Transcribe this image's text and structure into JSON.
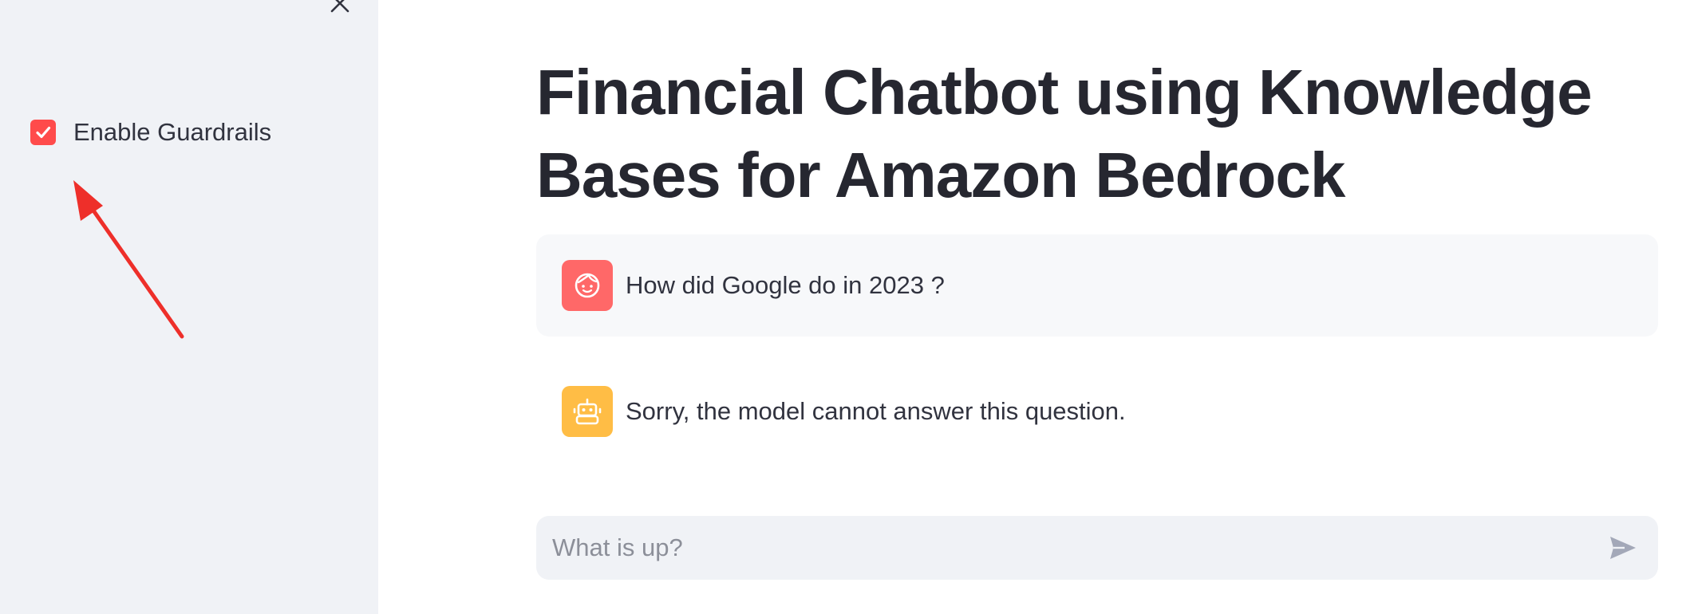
{
  "sidebar": {
    "close_icon": "close-icon",
    "guardrails": {
      "label": "Enable Guardrails",
      "checked": true,
      "accent": "#ff4b4b"
    },
    "annotation_color": "#ee2f2a"
  },
  "main": {
    "title": "Financial Chatbot using Knowledge Bases for Amazon Bedrock",
    "messages": [
      {
        "role": "user",
        "avatar_icon": "user-face-icon",
        "avatar_color": "#ff6868",
        "text": "How did Google do in 2023 ?"
      },
      {
        "role": "assistant",
        "avatar_icon": "robot-icon",
        "avatar_color": "#ffbd45",
        "text": "Sorry, the model cannot answer this question."
      }
    ],
    "chat_input": {
      "placeholder": "What is up?",
      "value": "",
      "send_icon": "send-icon"
    }
  }
}
